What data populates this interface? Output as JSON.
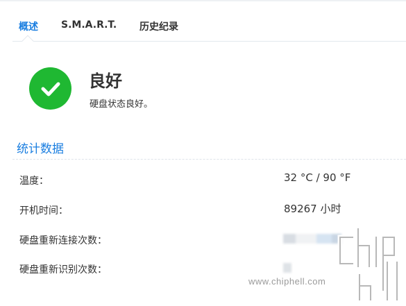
{
  "tabs": [
    {
      "label": "概述",
      "active": true
    },
    {
      "label": "S.M.A.R.T.",
      "active": false
    },
    {
      "label": "历史纪录",
      "active": false
    }
  ],
  "status": {
    "icon": "check-circle-icon",
    "title": "良好",
    "description": "硬盘状态良好。",
    "color": "#1fb832"
  },
  "stats": {
    "title": "统计数据",
    "rows": [
      {
        "label": "温度：",
        "value": "32 °C / 90 °F"
      },
      {
        "label": "开机时间：",
        "value": "89267 小时"
      },
      {
        "label": "硬盘重新连接次数：",
        "value": null,
        "redacted": true
      },
      {
        "label": "硬盘重新识别次数：",
        "value": null,
        "redacted": true
      }
    ]
  },
  "watermark": {
    "text": "www.chiphell.com",
    "logo_text": "chip hell"
  },
  "colors": {
    "accent": "#1a7ee0",
    "success": "#1fb832",
    "text": "#333333"
  }
}
